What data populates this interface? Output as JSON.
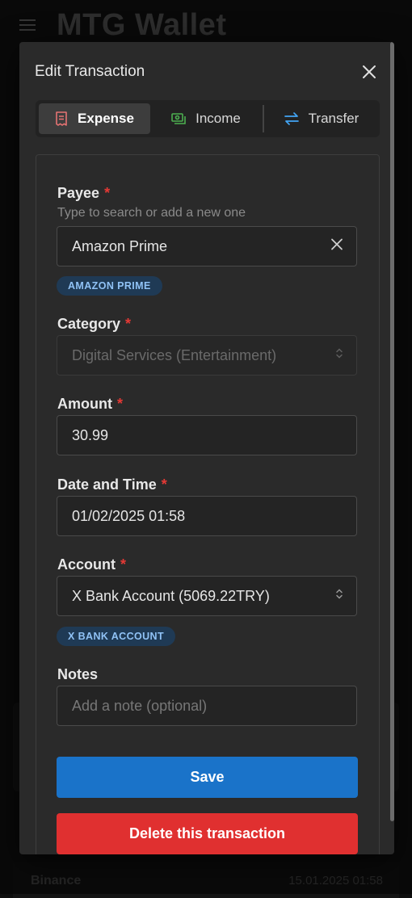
{
  "app": {
    "title": "MTG Wallet"
  },
  "background": {
    "row_left": "Binance",
    "row_right": "15.01.2025 01:58"
  },
  "dialog": {
    "title": "Edit Transaction",
    "tabs": [
      {
        "label": "Expense",
        "icon": "receipt-icon",
        "color": "#e57373",
        "active": true
      },
      {
        "label": "Income",
        "icon": "cash-icon",
        "color": "#4caf50",
        "active": false
      },
      {
        "label": "Transfer",
        "icon": "swap-icon",
        "color": "#42a5f5",
        "active": false
      }
    ],
    "payee": {
      "label": "Payee",
      "required_mark": "*",
      "helper": "Type to search or add a new one",
      "value": "Amazon Prime",
      "chip": "AMAZON PRIME"
    },
    "category": {
      "label": "Category",
      "required_mark": "*",
      "value": "Digital Services (Entertainment)"
    },
    "amount": {
      "label": "Amount",
      "required_mark": "*",
      "value": "30.99"
    },
    "datetime": {
      "label": "Date and Time",
      "required_mark": "*",
      "value": "01/02/2025 01:58"
    },
    "account": {
      "label": "Account",
      "required_mark": "*",
      "value": "X Bank Account (5069.22TRY)",
      "chip": "X BANK ACCOUNT"
    },
    "notes": {
      "label": "Notes",
      "placeholder": "Add a note (optional)"
    },
    "save_label": "Save",
    "delete_label": "Delete this transaction"
  },
  "colors": {
    "accent_blue": "#1a73c9",
    "danger_red": "#e03030",
    "required_red": "#e53935",
    "chip_bg": "#1f3a55",
    "chip_text": "#90c2f5"
  }
}
